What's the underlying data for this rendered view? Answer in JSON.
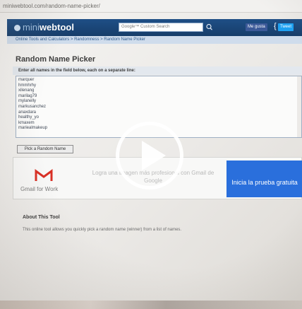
{
  "browser": {
    "url": "miniwebtool.com/random-name-picker/"
  },
  "site": {
    "logo_mini": "mini",
    "logo_web": "webtool",
    "search_placeholder": "Google™ Custom Search",
    "share_facebook": "Me gusta",
    "share_twitter": "Tweet"
  },
  "breadcrumb": "Online Tools and Calculators > Randomness > Random Name Picker",
  "tool": {
    "title": "Random Name Picker",
    "instructions": "Enter all names in the field below, each on a separate line:",
    "names": [
      "marquer",
      "hmmhrhy",
      "xilenang",
      "marilag79",
      "mylanelly",
      "markusanchez",
      "anaxdara",
      "healthy_yo",
      "kmaxem",
      "mariealmakeup"
    ],
    "pick_button": "Pick a Random Name"
  },
  "ad": {
    "brand": "Gmail for Work",
    "text": "Logra una imagen más profesional con Gmail de Google",
    "cta": "Inicia la prueba gratuita"
  },
  "about": {
    "title": "About This Tool",
    "text": "This online tool allows you quickly pick a random name (winner) from a list of names."
  },
  "colors": {
    "header": "#1f4f86",
    "ad_cta": "#2a6fdc",
    "gmail_red": "#d93025"
  }
}
